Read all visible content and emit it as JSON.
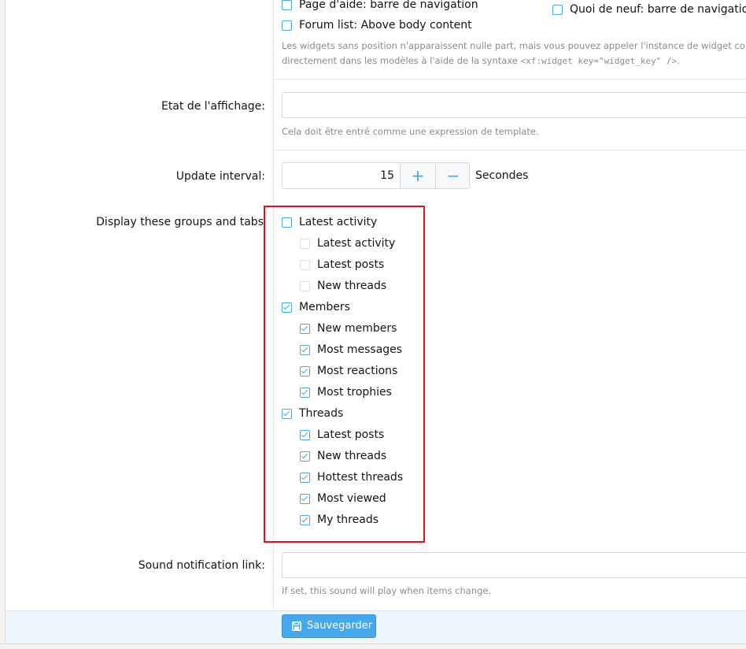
{
  "positions": {
    "help_page_nav": "Page d'aide: barre de navigation",
    "forum_list_above": "Forum list: Above body content",
    "whats_new_nav": "Quoi de neuf: barre de navigation",
    "hint_line1": "Les widgets sans position n'apparaissent nulle part, mais vous pouvez appeler l'instance de widget co",
    "hint_line2_prefix": "directement dans les modèles à l'aide de la syntaxe ",
    "hint_line2_code": "<xf:widget key=\"widget_key\" />",
    "hint_line2_suffix": "."
  },
  "display_condition": {
    "label": "Etat de l'affichage:",
    "value": "",
    "hint": "Cela doit être entré comme une expression de template."
  },
  "update_interval": {
    "label": "Update interval:",
    "value": "15",
    "plus": "+",
    "minus": "−",
    "unit": "Secondes"
  },
  "groups": {
    "label": "Display these groups and tabs",
    "items": [
      {
        "label": "Latest activity",
        "checked": false,
        "children": [
          {
            "label": "Latest activity",
            "checked": false,
            "disabled": true
          },
          {
            "label": "Latest posts",
            "checked": false,
            "disabled": true
          },
          {
            "label": "New threads",
            "checked": false,
            "disabled": true
          }
        ]
      },
      {
        "label": "Members",
        "checked": true,
        "children": [
          {
            "label": "New members",
            "checked": true
          },
          {
            "label": "Most messages",
            "checked": true
          },
          {
            "label": "Most reactions",
            "checked": true
          },
          {
            "label": "Most trophies",
            "checked": true
          }
        ]
      },
      {
        "label": "Threads",
        "checked": true,
        "children": [
          {
            "label": "Latest posts",
            "checked": true
          },
          {
            "label": "New threads",
            "checked": true
          },
          {
            "label": "Hottest threads",
            "checked": true
          },
          {
            "label": "Most viewed",
            "checked": true
          },
          {
            "label": "My threads",
            "checked": true
          }
        ]
      }
    ]
  },
  "sound": {
    "label": "Sound notification link:",
    "value": "",
    "hint": "If set, this sound will play when items change."
  },
  "footer": {
    "save_label": "Sauvegarder",
    "save_icon": "floppy-disk-icon"
  },
  "colors": {
    "accent": "#47a7eb",
    "highlight": "#e0141e"
  }
}
